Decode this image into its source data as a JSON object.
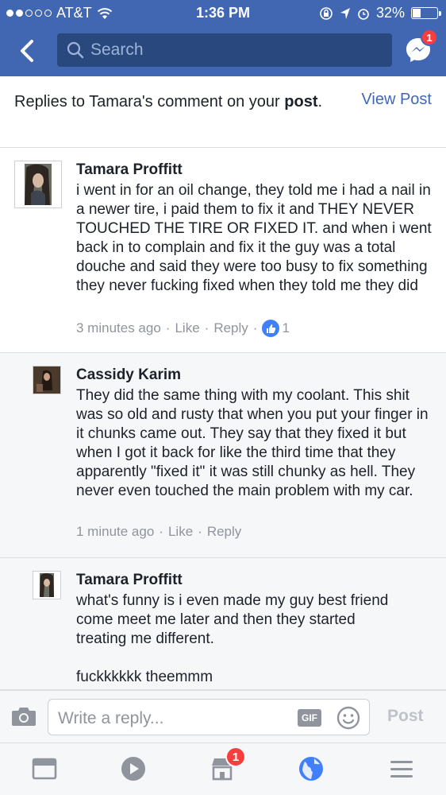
{
  "status_bar": {
    "carrier": "AT&T",
    "time": "1:36 PM",
    "battery": "32%",
    "battery_level": 0.32
  },
  "nav": {
    "search_placeholder": "Search",
    "messenger_badge": "1"
  },
  "header": {
    "title_prefix": "Replies to Tamara's comment on your",
    "title_bold": "post",
    "title_suffix": ".",
    "view_post": "View Post"
  },
  "comments": [
    {
      "author": "Tamara Proffitt",
      "text": "i went in for an oil change, they told me i had a nail in a newer tire, i paid them to fix it and THEY NEVER TOUCHED THE TIRE OR FIXED IT. and when i went back in to complain and fix it the guy was a total douche and said they were too busy to fix something they never fucking fixed when they told me they did",
      "time": "3 minutes ago",
      "like": "Like",
      "reply": "Reply",
      "like_count": "1"
    },
    {
      "author": "Cassidy Karim",
      "text": "They did the same thing with my coolant. This shit was so old and rusty that when you put your finger in it chunks came out. They say that they fixed it but when I got it back for like the third time that they apparently \"fixed it\" it was still chunky as hell. They never even touched the main problem with my car.",
      "time": "1 minute ago",
      "like": "Like",
      "reply": "Reply"
    },
    {
      "author": "Tamara Proffitt",
      "text": "what's funny is i even made my guy best friend come meet me later and then they started treating me different.",
      "text2": "fuckkkkkk theemmm"
    }
  ],
  "reply_bar": {
    "placeholder": "Write a reply...",
    "gif": "GIF",
    "post": "Post"
  },
  "tab_bar": {
    "marketplace_badge": "1"
  },
  "colors": {
    "brand": "#4267b2",
    "badge": "#fa3e3e",
    "link": "#4267b2",
    "globe": "#4080ff"
  }
}
